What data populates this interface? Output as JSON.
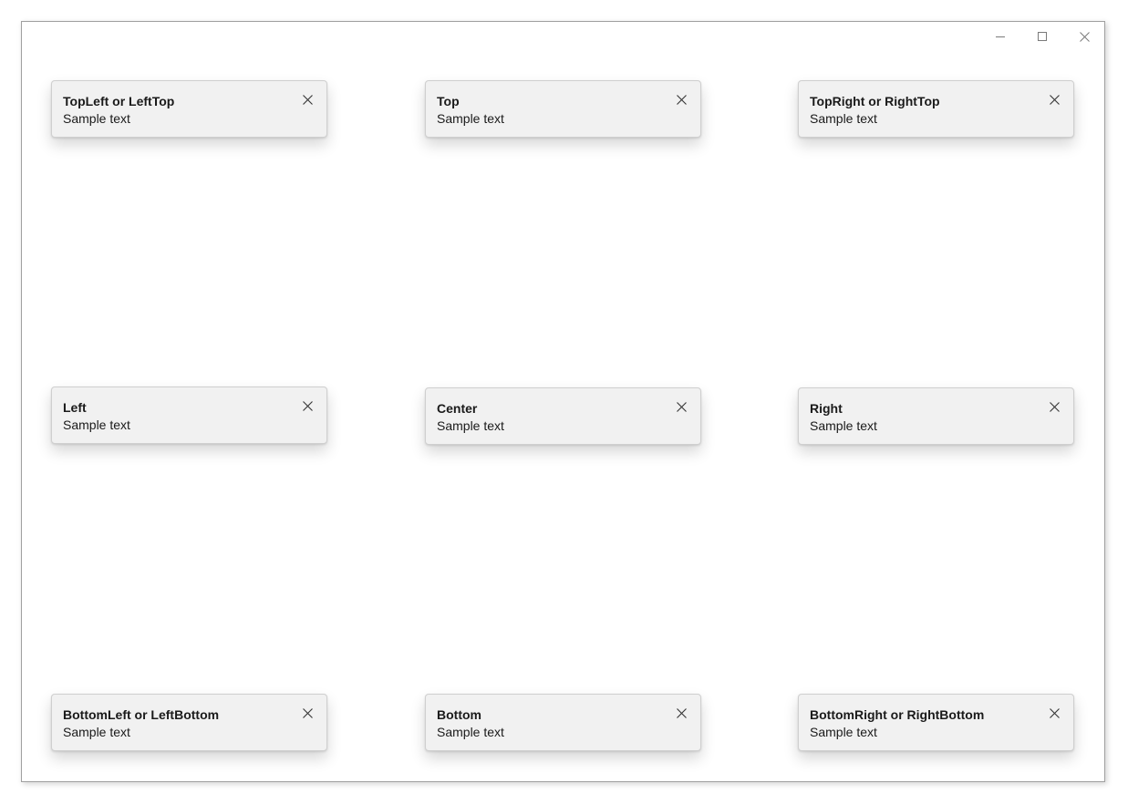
{
  "window": {
    "controls": {
      "minimize": "minimize-icon",
      "maximize": "maximize-icon",
      "close": "close-icon"
    }
  },
  "teaching_tips": [
    {
      "placement": "TopLeft",
      "title": "TopLeft or LeftTop",
      "subtitle": "Sample text",
      "close_icon": "close-icon"
    },
    {
      "placement": "Top",
      "title": "Top",
      "subtitle": "Sample text",
      "close_icon": "close-icon"
    },
    {
      "placement": "TopRight",
      "title": "TopRight or RightTop",
      "subtitle": "Sample text",
      "close_icon": "close-icon"
    },
    {
      "placement": "Left",
      "title": "Left",
      "subtitle": "Sample text",
      "close_icon": "close-icon"
    },
    {
      "placement": "Center",
      "title": "Center",
      "subtitle": "Sample text",
      "close_icon": "close-icon"
    },
    {
      "placement": "Right",
      "title": "Right",
      "subtitle": "Sample text",
      "close_icon": "close-icon"
    },
    {
      "placement": "BottomLeft",
      "title": "BottomLeft or LeftBottom",
      "subtitle": "Sample text",
      "close_icon": "close-icon"
    },
    {
      "placement": "Bottom",
      "title": "Bottom",
      "subtitle": "Sample text",
      "close_icon": "close-icon"
    },
    {
      "placement": "BottomRight",
      "title": "BottomRight or RightBottom",
      "subtitle": "Sample text",
      "close_icon": "close-icon"
    }
  ]
}
